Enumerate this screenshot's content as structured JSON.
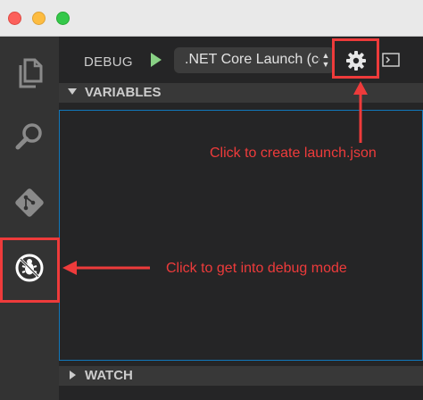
{
  "window": {
    "traffic_lights": [
      "close",
      "minimize",
      "zoom"
    ]
  },
  "activity_bar": {
    "items": [
      {
        "name": "explorer",
        "icon": "files-icon"
      },
      {
        "name": "search",
        "icon": "search-icon"
      },
      {
        "name": "git",
        "icon": "git-icon"
      },
      {
        "name": "debug",
        "icon": "debug-icon",
        "active": true
      }
    ]
  },
  "debug": {
    "title": "DEBUG",
    "launch_config": ".NET Core Launch (co",
    "start_icon": "play-icon",
    "config_icon": "gear-icon",
    "console_icon": "terminal-icon"
  },
  "sections": {
    "variables": "VARIABLES",
    "watch": "WATCH"
  },
  "annotations": {
    "launch_json": "Click to create launch.json",
    "debug_mode": "Click to get into debug mode",
    "color": "#ee3b3b"
  },
  "colors": {
    "play": "#89d185",
    "focus_border": "#1177bb"
  }
}
